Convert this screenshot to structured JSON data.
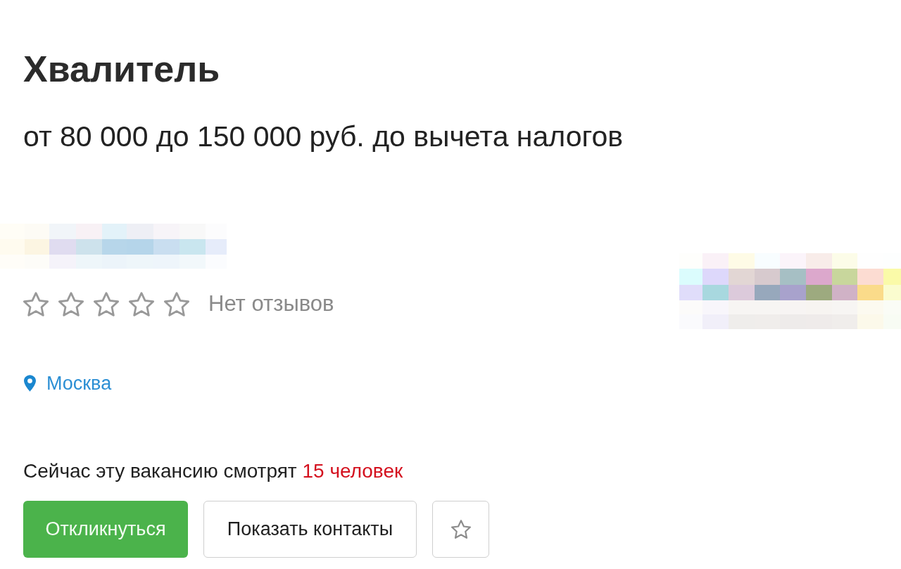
{
  "vacancy": {
    "title": "Хвалитель",
    "salary": "от 80 000 до 150 000 руб. до вычета налогов"
  },
  "employer": {
    "rating": {
      "stars": 0,
      "label": "Нет отзывов"
    },
    "location": "Москва"
  },
  "viewers": {
    "text": "Сейчас эту вакансию смотрят",
    "count": "15 человек"
  },
  "actions": [
    {
      "kind": "primary",
      "label": "Откликнуться"
    },
    {
      "kind": "secondary",
      "label": "Показать контакты"
    },
    {
      "kind": "favorite"
    }
  ]
}
